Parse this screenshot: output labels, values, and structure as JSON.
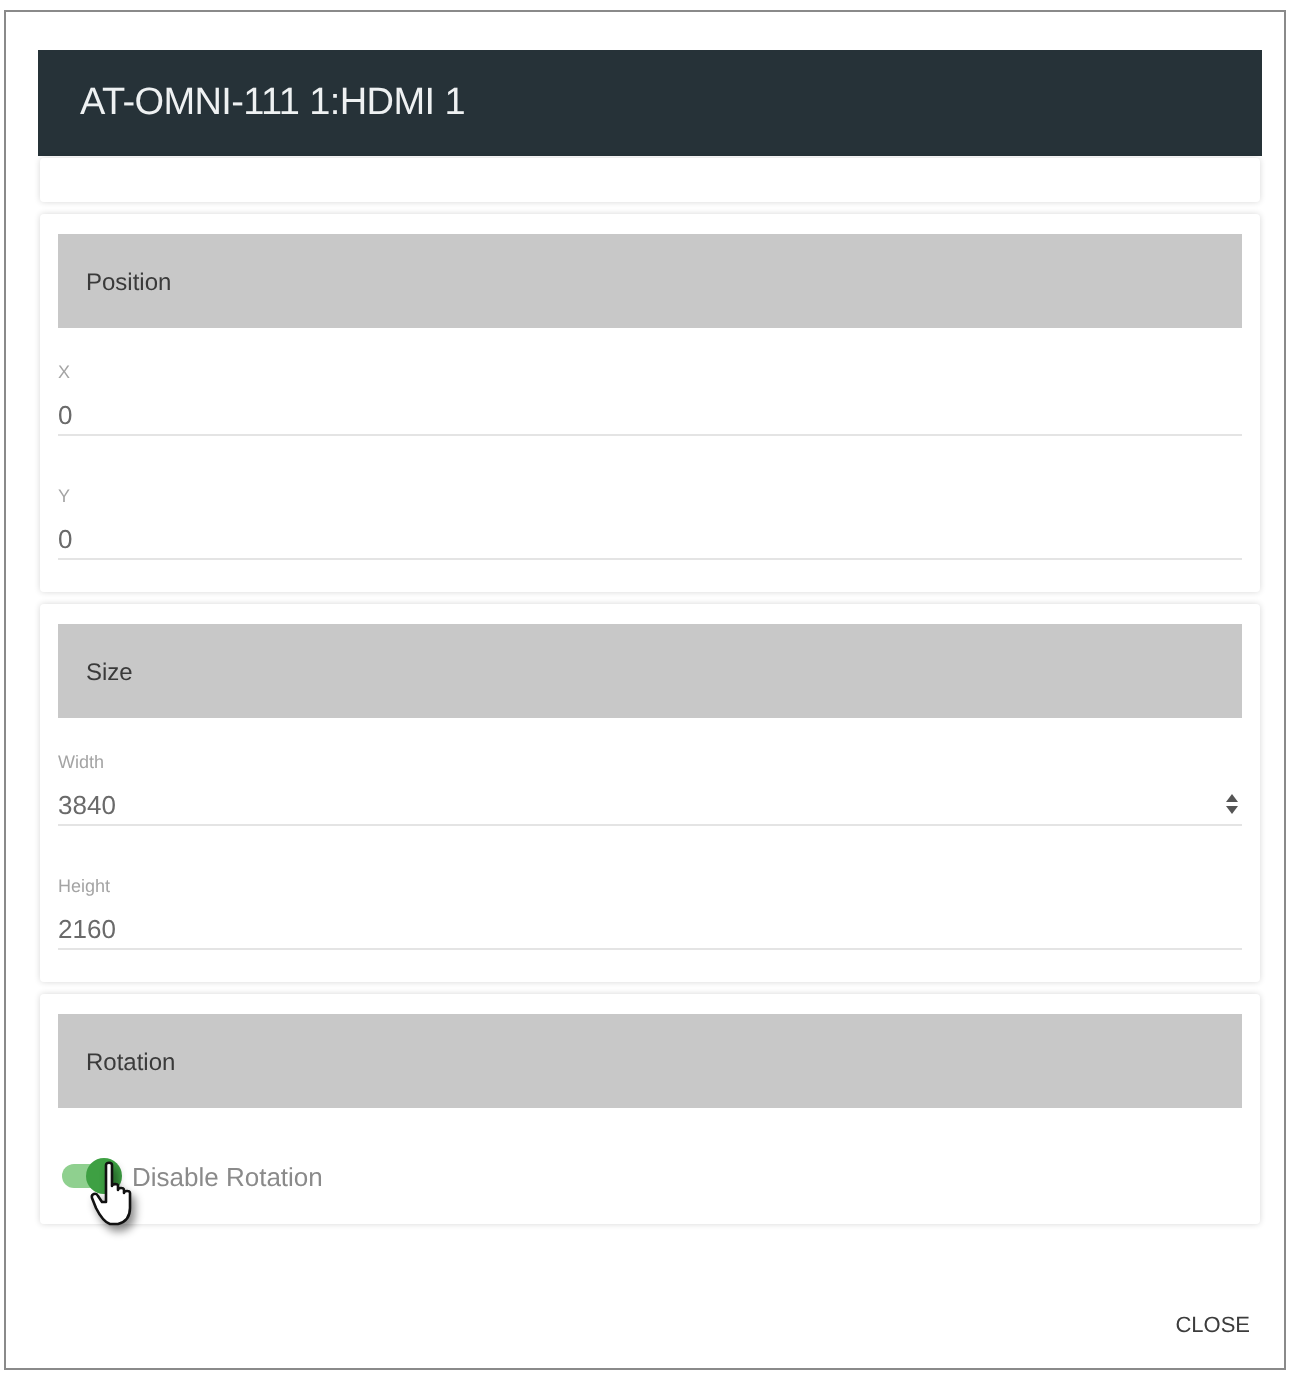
{
  "dialog": {
    "title": "AT-OMNI-111 1:HDMI 1"
  },
  "sections": [
    {
      "heading": "Position",
      "fields": [
        {
          "label": "X",
          "value": "0",
          "kind": "text"
        },
        {
          "label": "Y",
          "value": "0",
          "kind": "text"
        }
      ]
    },
    {
      "heading": "Size",
      "fields": [
        {
          "label": "Width",
          "value": "3840",
          "kind": "number"
        },
        {
          "label": "Height",
          "value": "2160",
          "kind": "text"
        }
      ]
    },
    {
      "heading": "Rotation",
      "toggle": {
        "label": "Disable Rotation",
        "on": true
      }
    }
  ],
  "buttons": [
    {
      "label": "CLOSE"
    }
  ]
}
